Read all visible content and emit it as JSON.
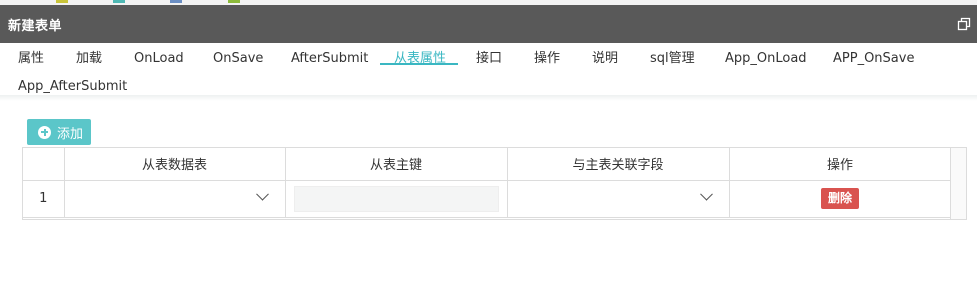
{
  "window": {
    "title": "新建表单"
  },
  "tabs": [
    {
      "label": "属性",
      "active": false
    },
    {
      "label": "加载",
      "active": false
    },
    {
      "label": "OnLoad",
      "active": false
    },
    {
      "label": "OnSave",
      "active": false
    },
    {
      "label": "AfterSubmit",
      "active": false
    },
    {
      "label": "从表属性",
      "active": true
    },
    {
      "label": "接口",
      "active": false
    },
    {
      "label": "操作",
      "active": false
    },
    {
      "label": "说明",
      "active": false
    },
    {
      "label": "sql管理",
      "active": false
    },
    {
      "label": "App_OnLoad",
      "active": false
    },
    {
      "label": "APP_OnSave",
      "active": false
    },
    {
      "label": "App_AfterSubmit",
      "active": false
    }
  ],
  "toolbar": {
    "add_label": "添加"
  },
  "grid": {
    "columns": [
      "从表数据表",
      "从表主键",
      "与主表关联字段",
      "操作"
    ],
    "rows": [
      {
        "index": "1",
        "sub_table": "",
        "sub_key": "",
        "link_field": "",
        "delete_label": "删除"
      }
    ]
  },
  "colors": {
    "titlebar": "#595959",
    "accent": "#3ab7c2",
    "add_button": "#5bc6c9",
    "delete_button": "#d9534f"
  }
}
